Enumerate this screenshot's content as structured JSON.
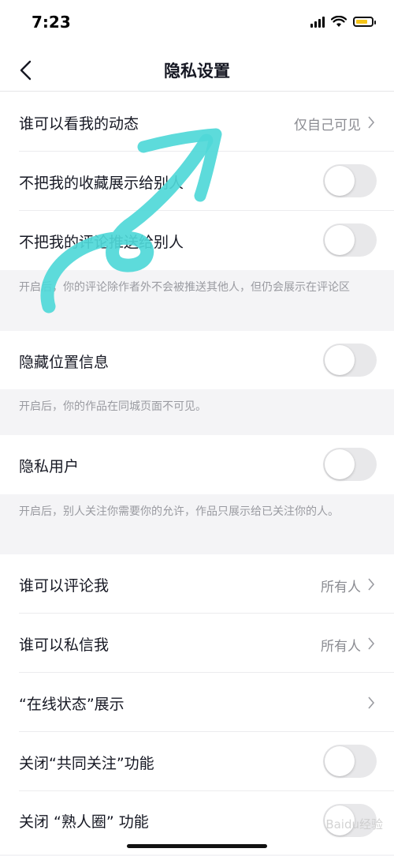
{
  "status_bar": {
    "time": "7:23"
  },
  "nav": {
    "title": "隐私设置"
  },
  "rows": {
    "who_can_see_activity": {
      "label": "谁可以看我的动态",
      "value": "仅自己可见"
    },
    "hide_favorites": {
      "label": "不把我的收藏展示给别人"
    },
    "no_push_comments": {
      "label": "不把我的评论推送给别人"
    },
    "hide_location": {
      "label": "隐藏位置信息"
    },
    "private_user": {
      "label": "隐私用户"
    },
    "who_can_comment": {
      "label": "谁可以评论我",
      "value": "所有人"
    },
    "who_can_message": {
      "label": "谁可以私信我",
      "value": "所有人"
    },
    "online_status": {
      "label": "“在线状态”展示"
    },
    "close_mutual_follow": {
      "label": "关闭“共同关注”功能"
    },
    "close_acquaintance": {
      "label": "关闭 “熟人圈” 功能"
    }
  },
  "notes": {
    "comments_note": "开启后，你的评论除作者外不会被推送其他人，但仍会展示在评论区",
    "location_note": "开启后，你的作品在同城页面不可见。",
    "private_note": "开启后，别人关注你需要你的允许，作品只展示给已关注你的人。"
  },
  "toggles": {
    "hide_favorites": false,
    "no_push_comments": false,
    "hide_location": false,
    "private_user": false,
    "close_mutual_follow": false,
    "close_acquaintance": false
  },
  "watermark": "Baidu经验",
  "colors": {
    "annotation": "#4fd8d8",
    "battery": "#f5c518",
    "toggle_off": "#e8e8ea"
  }
}
